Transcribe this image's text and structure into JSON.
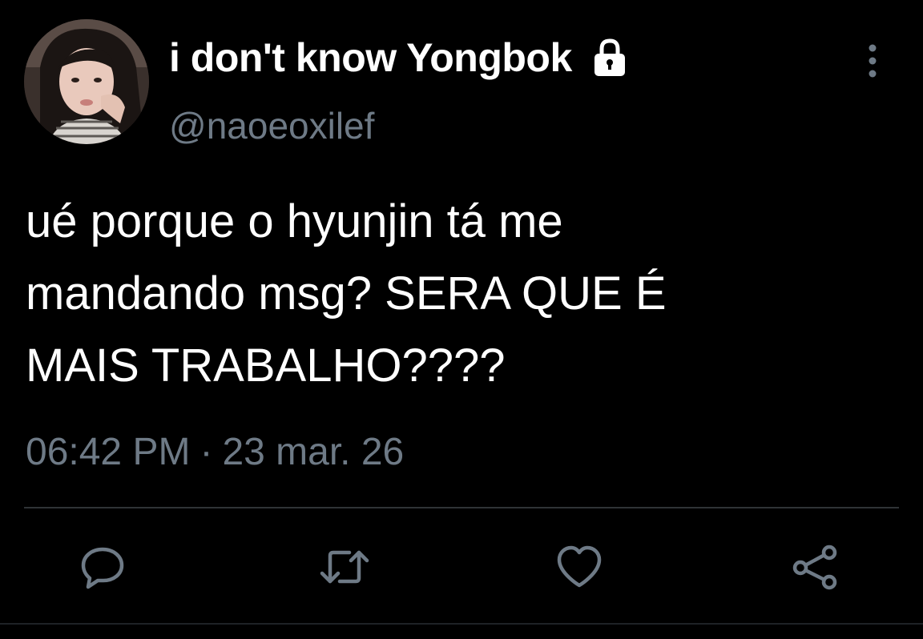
{
  "colors": {
    "background": "#000000",
    "text_primary": "#ffffff",
    "text_secondary": "#6e7a86",
    "divider": "#2f3336"
  },
  "user": {
    "display_name": "i don't know Yongbok",
    "handle": "@naoeoxilef",
    "protected_icon": "lock-icon",
    "avatar_icon": "profile-photo"
  },
  "tweet": {
    "text": "ué porque o hyunjin tá me\nmandando msg? SERA QUE É\nMAIS TRABALHO????",
    "time": "06:42 PM",
    "separator": "·",
    "date": "23 mar. 26"
  },
  "actions": [
    {
      "icon": "reply-icon"
    },
    {
      "icon": "retweet-icon"
    },
    {
      "icon": "like-icon"
    },
    {
      "icon": "share-icon"
    }
  ],
  "menu": {
    "icon": "more-vertical-icon"
  }
}
